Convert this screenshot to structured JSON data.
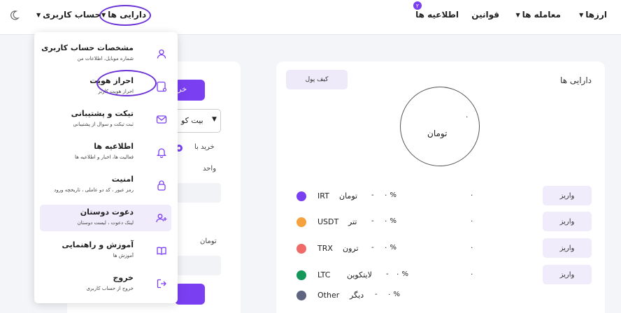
{
  "header": {
    "nav": {
      "currencies": "ارزها",
      "trade": "معامله ها",
      "rules": "قوانین",
      "announcements": "اطلاعیه ها",
      "assets": "دارایی ها",
      "account": "حساب کاربری"
    },
    "announcements_badge": "۲"
  },
  "dropdown": {
    "items": [
      {
        "title": "مشخصات حساب کاربری",
        "subtitle": "شماره موبایل، اطلاعات من",
        "icon": "user-icon"
      },
      {
        "title": "احراز هویت",
        "subtitle": "احراز هویت کاربر",
        "icon": "id-card-icon"
      },
      {
        "title": "تیکت و پشتیبانی",
        "subtitle": "ثبت تیکت و سوال از پشتیبانی",
        "icon": "mail-icon"
      },
      {
        "title": "اطلاعیه ها",
        "subtitle": "فعالیت ها، اخبار و اطلاعیه ها",
        "icon": "bell-icon"
      },
      {
        "title": "امنیت",
        "subtitle": "رمز عبور ، کد دو عاملی ، تاریخچه ورود",
        "icon": "lock-icon"
      },
      {
        "title": "دعوت دوستان",
        "subtitle": "لینک دعوت ، لیست دوستان",
        "icon": "user-plus-icon"
      },
      {
        "title": "آموزش و راهنمایی",
        "subtitle": "آموزش ها",
        "icon": "book-icon"
      },
      {
        "title": "خروج",
        "subtitle": "خروج از حساب کاربری",
        "icon": "logout-icon"
      }
    ]
  },
  "trade_panel": {
    "buy_button_partial": "خر",
    "coin_select_partial": "بیت کو",
    "buy_radio_label": "خرید با",
    "unit_label": "واحد",
    "toman_label": "تومان"
  },
  "assets_panel": {
    "title": "دارایی ها",
    "wallet_button": "کیف پول",
    "donut_value": "۰",
    "donut_label": "تومان",
    "deposit_label": "واریز",
    "rows": [
      {
        "symbol": "IRT",
        "name": "تومان",
        "percent": "% ۰",
        "dash": "-",
        "amount": "۰",
        "color": "#7b3ff2",
        "has_deposit": true
      },
      {
        "symbol": "USDT",
        "name": "تتر",
        "percent": "% ۰",
        "dash": "-",
        "amount": "۰",
        "color": "#f5a13d",
        "has_deposit": true
      },
      {
        "symbol": "TRX",
        "name": "ترون",
        "percent": "% ۰",
        "dash": "-",
        "amount": "۰",
        "color": "#f06a6a",
        "has_deposit": true
      },
      {
        "symbol": "LTC",
        "name": "لایتکوین",
        "percent": "% ۰",
        "dash": "-",
        "amount": "۰",
        "color": "#13985a",
        "has_deposit": true
      },
      {
        "symbol": "Other",
        "name": "دیگر",
        "percent": "% ۰",
        "dash": "-",
        "amount": "",
        "color": "#5f6580",
        "has_deposit": false
      }
    ]
  }
}
